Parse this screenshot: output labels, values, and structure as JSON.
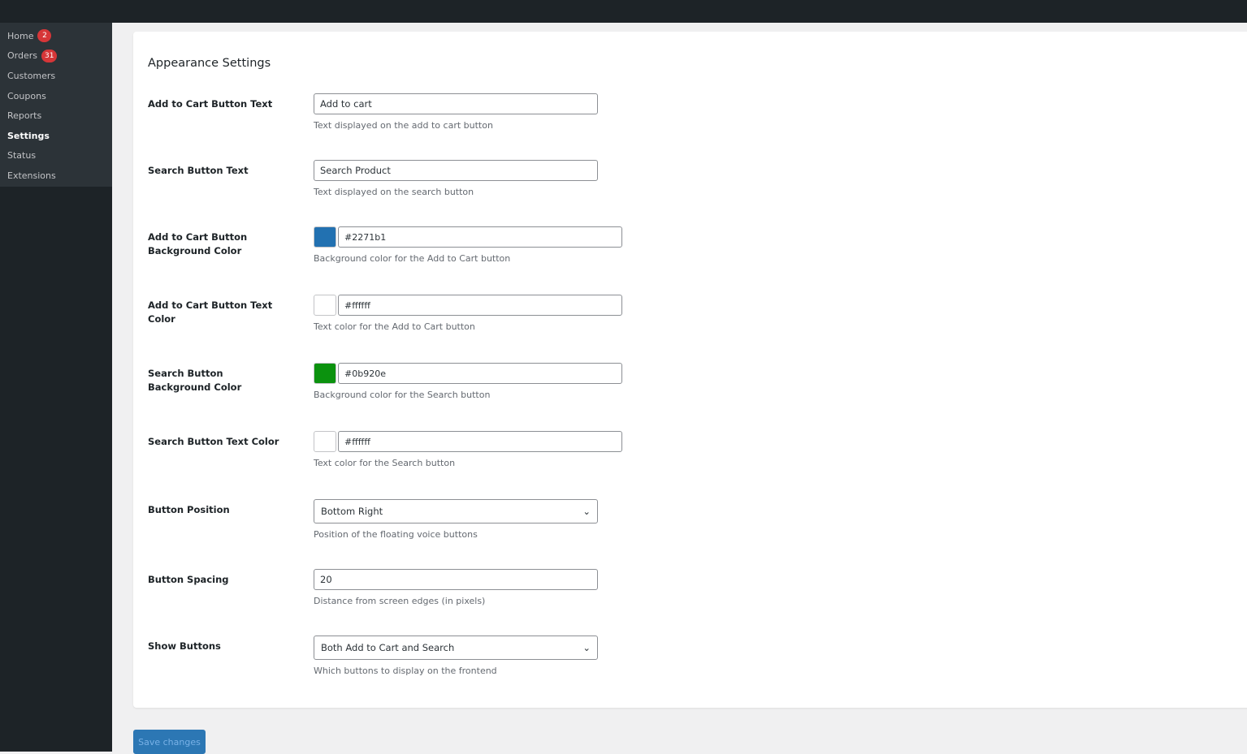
{
  "sidebar": {
    "items": [
      {
        "label": "Home",
        "badge": "2"
      },
      {
        "label": "Orders",
        "badge": "31"
      },
      {
        "label": "Customers"
      },
      {
        "label": "Coupons"
      },
      {
        "label": "Reports"
      },
      {
        "label": "Settings"
      },
      {
        "label": "Status"
      },
      {
        "label": "Extensions"
      }
    ]
  },
  "title": "Appearance Settings",
  "fields": [
    {
      "label": "Add to Cart Button Text",
      "value": "Add to cart",
      "desc": "Text displayed on the add to cart button"
    },
    {
      "label": "Search Button Text",
      "value": "Search Product",
      "desc": "Text displayed on the search button"
    },
    {
      "label": "Add to Cart Button Background Color",
      "value": "#2271b1",
      "desc": "Background color for the Add to Cart button"
    },
    {
      "label": "Add to Cart Button Text Color",
      "value": "#ffffff",
      "desc": "Text color for the Add to Cart button"
    },
    {
      "label": "Search Button Background Color",
      "value": "#0b920e",
      "desc": "Background color for the Search button"
    },
    {
      "label": "Search Button Text Color",
      "value": "#ffffff",
      "desc": "Text color for the Search button"
    },
    {
      "label": "Button Position",
      "value": "Bottom Right",
      "desc": "Position of the floating voice buttons"
    },
    {
      "label": "Button Spacing",
      "value": "20",
      "desc": "Distance from screen edges (in pixels)"
    },
    {
      "label": "Show Buttons",
      "value": "Both Add to Cart and Search",
      "desc": "Which buttons to display on the frontend"
    }
  ],
  "save_label": "Save changes"
}
